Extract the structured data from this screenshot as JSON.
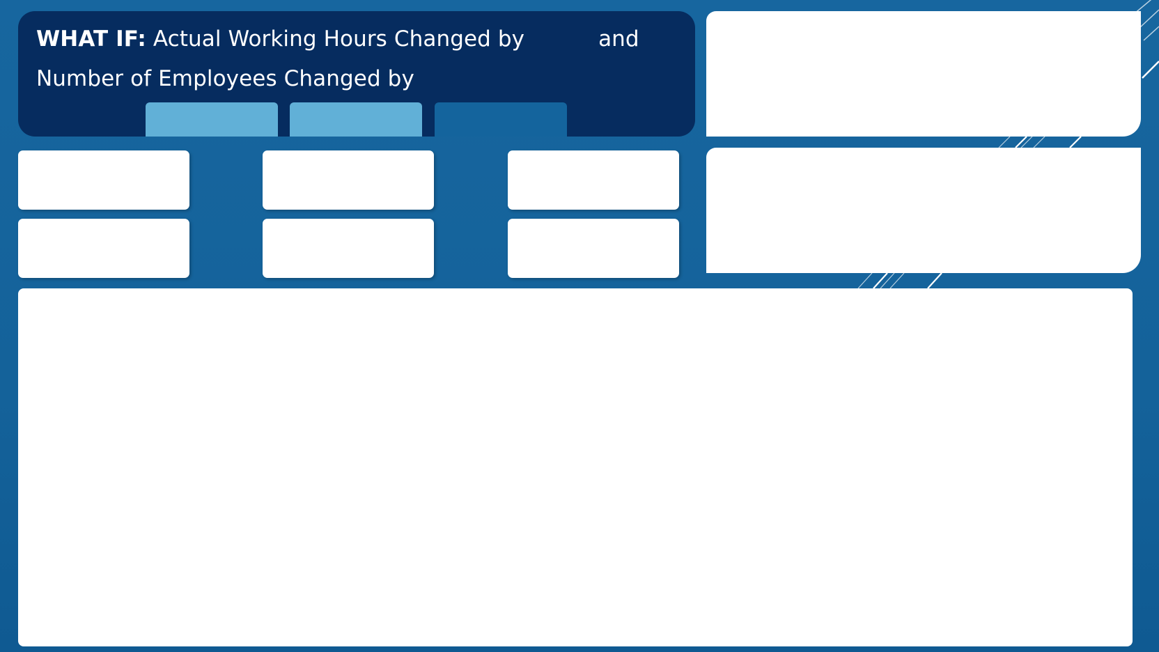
{
  "header": {
    "prefix": "WHAT IF:",
    "line1_text": "Actual Working Hours Changed by",
    "line1_suffix": "and",
    "line2_text": "Number of Employees Changed by"
  },
  "tabs": [
    {
      "label": ""
    },
    {
      "label": ""
    },
    {
      "label": ""
    }
  ],
  "kpi_cards": [
    {
      "value": ""
    },
    {
      "value": ""
    },
    {
      "value": ""
    },
    {
      "value": ""
    },
    {
      "value": ""
    },
    {
      "value": ""
    }
  ],
  "colors": {
    "background": "#17669f",
    "header_panel": "#062c5f",
    "tab_light": "#61b0d7",
    "tab_dark": "#14649d",
    "card": "#ffffff",
    "text": "#ffffff"
  }
}
